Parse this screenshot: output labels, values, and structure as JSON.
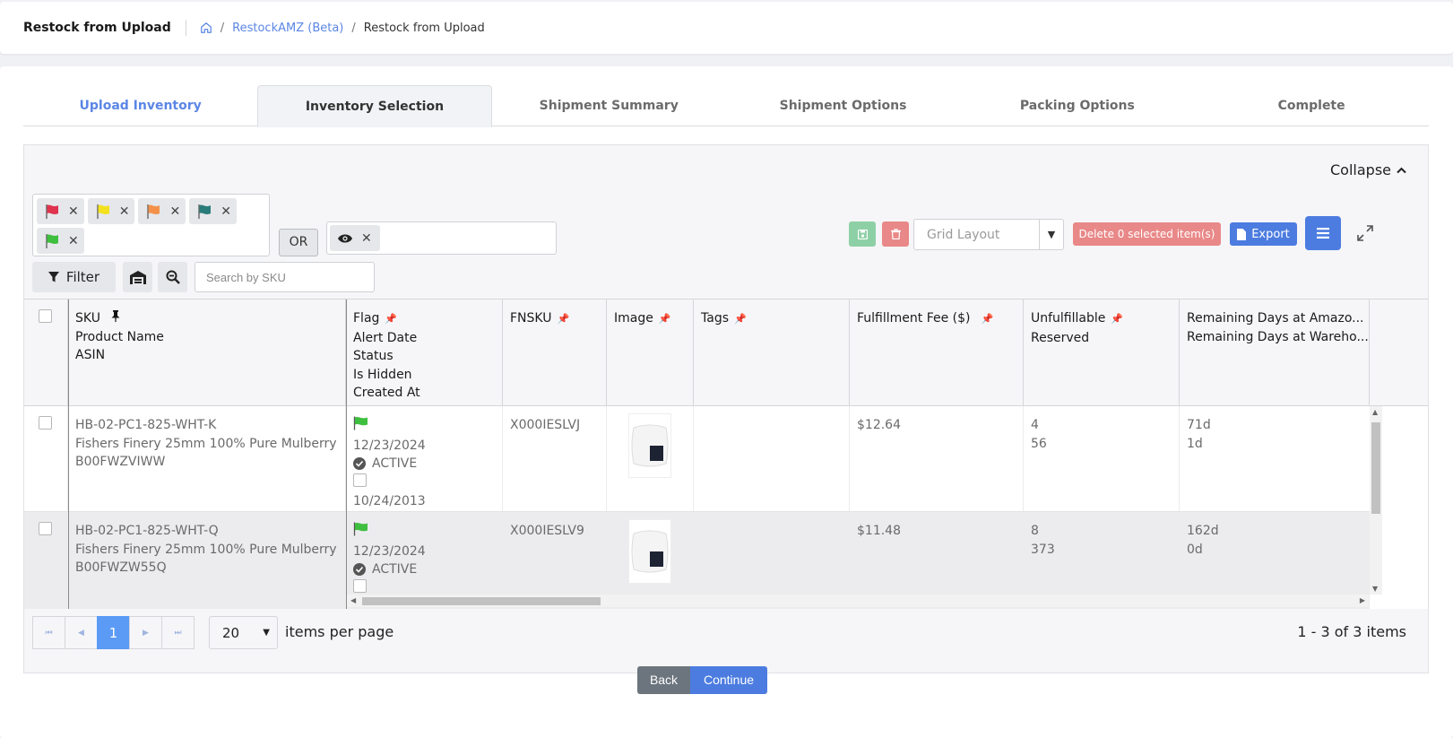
{
  "header": {
    "title": "Restock from Upload",
    "breadcrumb": {
      "home_icon": "home-icon",
      "link": "RestockAMZ (Beta)",
      "current": "Restock from Upload"
    }
  },
  "tabs": [
    {
      "label": "Upload Inventory",
      "state": "done"
    },
    {
      "label": "Inventory Selection",
      "state": "active"
    },
    {
      "label": "Shipment Summary",
      "state": "pending"
    },
    {
      "label": "Shipment Options",
      "state": "pending"
    },
    {
      "label": "Packing Options",
      "state": "pending"
    },
    {
      "label": "Complete",
      "state": "pending"
    }
  ],
  "toolbar": {
    "collapse_label": "Collapse",
    "flag_chips": [
      {
        "color": "#e0334e"
      },
      {
        "color": "#f3e11f"
      },
      {
        "color": "#f3914a"
      },
      {
        "color": "#2a7c7b"
      },
      {
        "color": "#3fbf3f"
      }
    ],
    "or_label": "OR",
    "filter_label": "Filter",
    "search_placeholder": "Search by SKU",
    "grid_layout_placeholder": "Grid Layout",
    "delete_label": "Delete 0 selected item(s)",
    "export_label": "Export"
  },
  "columns": [
    {
      "lines": [
        "SKU",
        "Product Name",
        "ASIN"
      ]
    },
    {
      "lines": [
        "Flag",
        "Alert Date",
        "Status",
        "Is Hidden",
        "Created At"
      ]
    },
    {
      "lines": [
        "FNSKU"
      ]
    },
    {
      "lines": [
        "Image"
      ]
    },
    {
      "lines": [
        "Tags"
      ]
    },
    {
      "lines": [
        "Fulfillment Fee ($)"
      ]
    },
    {
      "lines": [
        "Unfulfillable",
        "Reserved"
      ]
    },
    {
      "lines": [
        "Remaining Days at Amazo...",
        "Remaining Days at Wareho..."
      ]
    }
  ],
  "rows": [
    {
      "sku": "HB-02-PC1-825-WHT-K",
      "product_name": "Fishers Finery 25mm 100% Pure Mulberry",
      "asin": "B00FWZVIWW",
      "flag_color": "#3fbf3f",
      "alert_date": "12/23/2024",
      "status": "ACTIVE",
      "created_at": "10/24/2013",
      "fnsku": "X000IESLVJ",
      "fee": "$12.64",
      "unfulfillable": "4",
      "reserved": "56",
      "days_amazon": "71d",
      "days_warehouse": "1d"
    },
    {
      "sku": "HB-02-PC1-825-WHT-Q",
      "product_name": "Fishers Finery 25mm 100% Pure Mulberry",
      "asin": "B00FWZW55Q",
      "flag_color": "#3fbf3f",
      "alert_date": "12/23/2024",
      "status": "ACTIVE",
      "created_at": "",
      "fnsku": "X000IESLV9",
      "fee": "$11.48",
      "unfulfillable": "8",
      "reserved": "373",
      "days_amazon": "162d",
      "days_warehouse": "0d"
    }
  ],
  "pager": {
    "current_page": "1",
    "page_size": "20",
    "per_page_label": "items per page",
    "info": "1 - 3 of 3 items"
  },
  "footer": {
    "back_label": "Back",
    "continue_label": "Continue"
  }
}
